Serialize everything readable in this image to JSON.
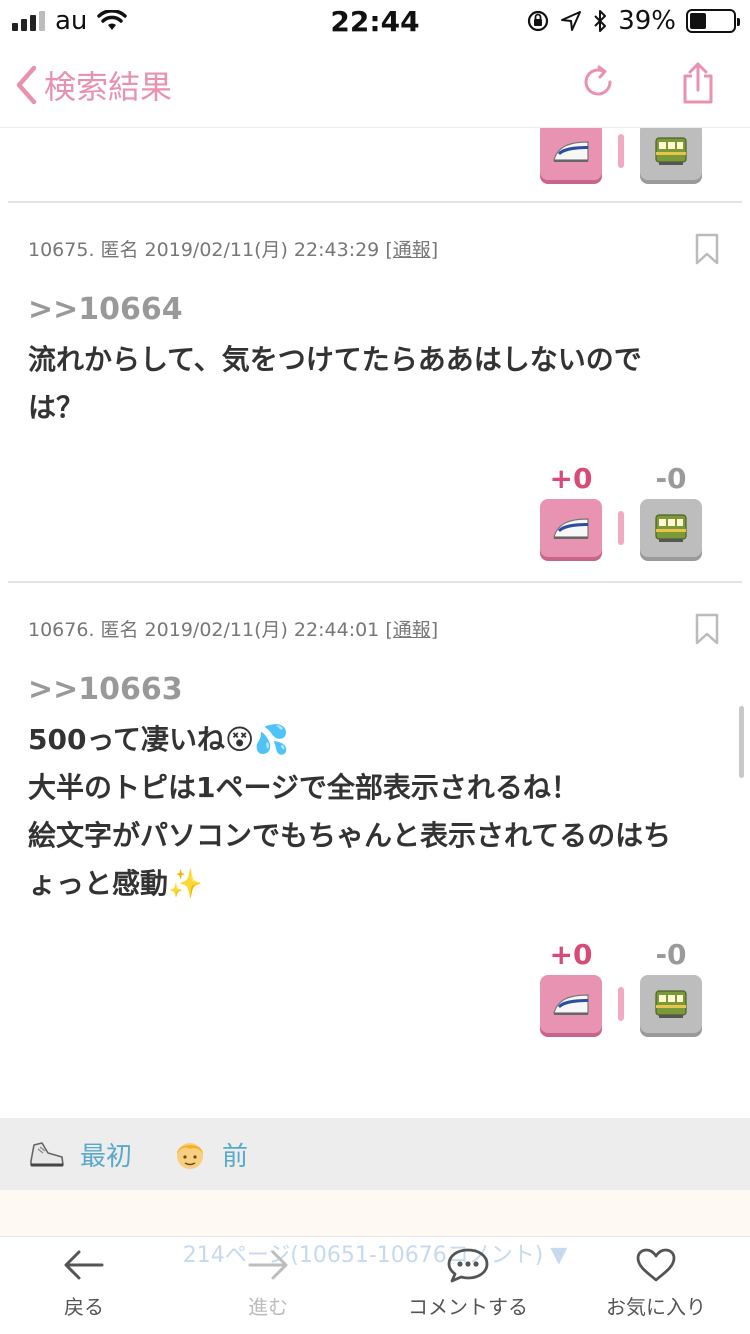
{
  "status_bar": {
    "carrier": "au",
    "time": "22:44",
    "battery_percent": "39%",
    "battery_level": 0.39
  },
  "nav": {
    "back_label": "検索結果",
    "accent_color": "#e892ae"
  },
  "posts": [
    {
      "meta_prefix": "10675. 匿名 2019/02/11(月) 22:43:29 ",
      "report_label": "[通報]",
      "anchor": ">>10664",
      "lines": [
        "流れからして、気をつけてたらああはしないので",
        "は？"
      ],
      "plus": "+0",
      "minus": "-0"
    },
    {
      "meta_prefix": "10676. 匿名 2019/02/11(月) 22:44:01 ",
      "report_label": "[通報]",
      "anchor": ">>10663",
      "lines": [
        "500って凄いね😵💦",
        "大半のトピは1ページで全部表示されるね！",
        "絵文字がパソコンでもちゃんと表示されてるのはち",
        "ょっと感動✨"
      ],
      "plus": "+0",
      "minus": "-0"
    }
  ],
  "vote_icons": {
    "plus": "bullet-train-icon",
    "minus": "tram-icon"
  },
  "pager": {
    "first_label": "最初",
    "prev_label": "前",
    "first_icon": "sneaker-icon",
    "prev_icon": "boy-face-icon"
  },
  "page_info": "214ページ(10651-10676コメント) ▼",
  "tabs": {
    "back": "戻る",
    "forward": "進む",
    "comment": "コメントする",
    "favorite": "お気に入り"
  }
}
